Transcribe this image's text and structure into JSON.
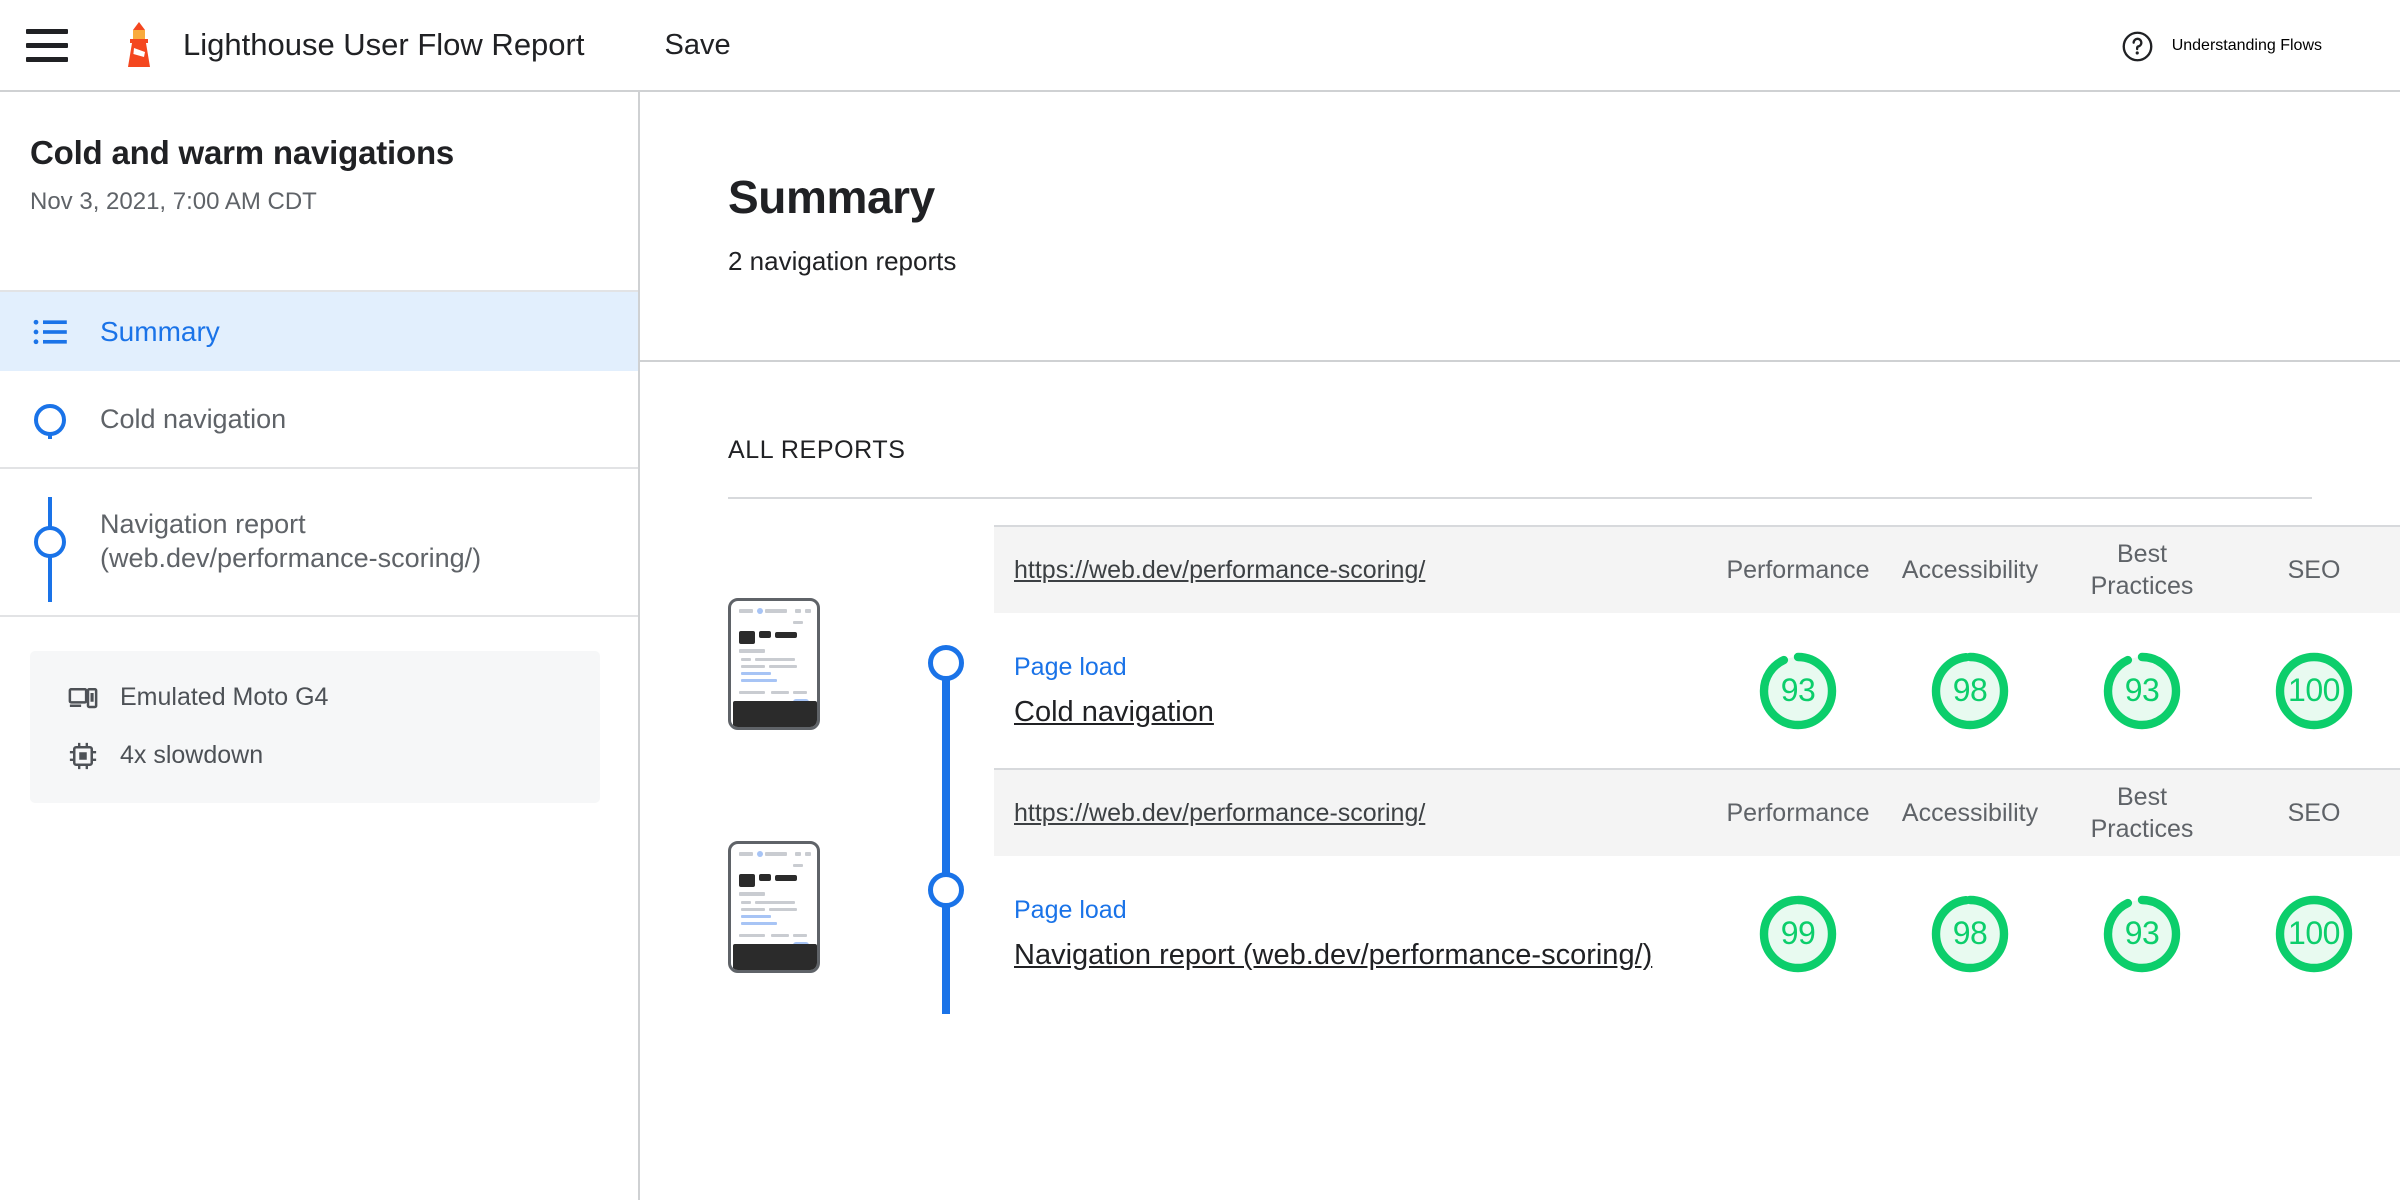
{
  "topbar": {
    "menu_icon": "hamburger-menu-icon",
    "logo_icon": "lighthouse-logo-icon",
    "title": "Lighthouse User Flow Report",
    "save_label": "Save",
    "help_icon": "help-circle-icon",
    "help_label": "Understanding Flows"
  },
  "sidebar": {
    "flow_title": "Cold and warm navigations",
    "flow_date": "Nov 3, 2021, 7:00 AM CDT",
    "items": [
      {
        "label": "Summary",
        "icon": "list-icon",
        "active": true
      },
      {
        "label": "Cold navigation",
        "icon": "timeline-node-icon",
        "active": false
      },
      {
        "label": "Navigation report (web.dev/performance-scoring/)",
        "icon": "timeline-node-icon",
        "active": false
      }
    ],
    "device": {
      "device_icon": "devices-icon",
      "device_label": "Emulated Moto G4",
      "cpu_icon": "cpu-chip-icon",
      "cpu_label": "4x slowdown"
    }
  },
  "main": {
    "title": "Summary",
    "subtitle": "2 navigation reports",
    "section_label": "ALL REPORTS",
    "columns": [
      "Performance",
      "Accessibility",
      "Best Practices",
      "SEO"
    ],
    "reports": [
      {
        "url": "https://web.dev/performance-scoring/",
        "gesture": "Page load",
        "name": "Cold navigation",
        "thumbnail": "page-screenshot-thumbnail",
        "scores": [
          {
            "category": "Performance",
            "value": 93
          },
          {
            "category": "Accessibility",
            "value": 98
          },
          {
            "category": "Best Practices",
            "value": 93
          },
          {
            "category": "SEO",
            "value": 100
          }
        ]
      },
      {
        "url": "https://web.dev/performance-scoring/",
        "gesture": "Page load",
        "name": "Navigation report (web.dev/performance-scoring/)",
        "thumbnail": "page-screenshot-thumbnail",
        "scores": [
          {
            "category": "Performance",
            "value": 99
          },
          {
            "category": "Accessibility",
            "value": 98
          },
          {
            "category": "Best Practices",
            "value": 93
          },
          {
            "category": "SEO",
            "value": 100
          }
        ]
      }
    ]
  },
  "colors": {
    "accent_blue": "#1a73e8",
    "score_green": "#0cce6b",
    "score_green_bg": "#e8faf0",
    "lighthouse_orange": "#f4471f",
    "lighthouse_light": "#f9ab3d",
    "sidebar_active_bg": "#e2effd",
    "header_row_bg": "#f4f4f4",
    "text_primary": "#202124",
    "text_secondary": "#5f6368"
  }
}
